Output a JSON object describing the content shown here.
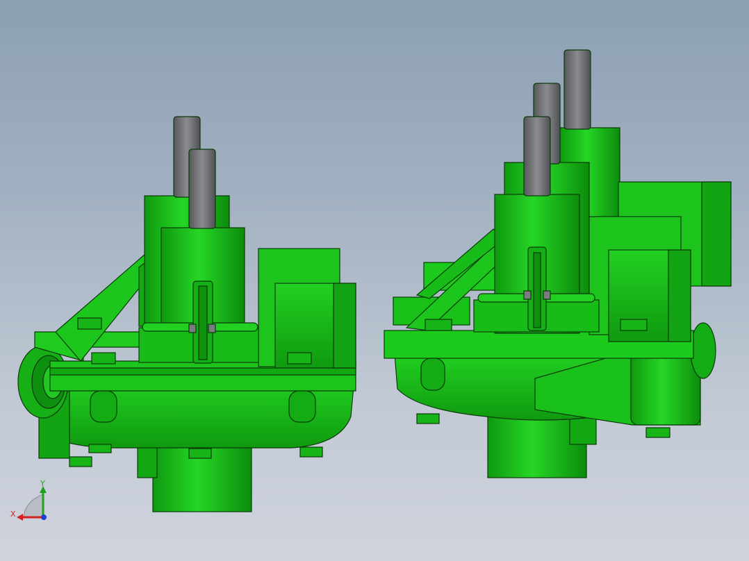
{
  "viewport": {
    "background_top": "#8c9fb3",
    "background_bottom": "#cfd3dc"
  },
  "model": {
    "body_color": "#1bc21b",
    "body_shade": "#10a010",
    "edge_color": "#0a3a0a",
    "shaft_color": "#6a6c70"
  },
  "triad": {
    "x_label": "X",
    "y_label": "Y",
    "x_color": "#d42020",
    "y_color": "#20a020",
    "z_color": "#2040d0"
  }
}
